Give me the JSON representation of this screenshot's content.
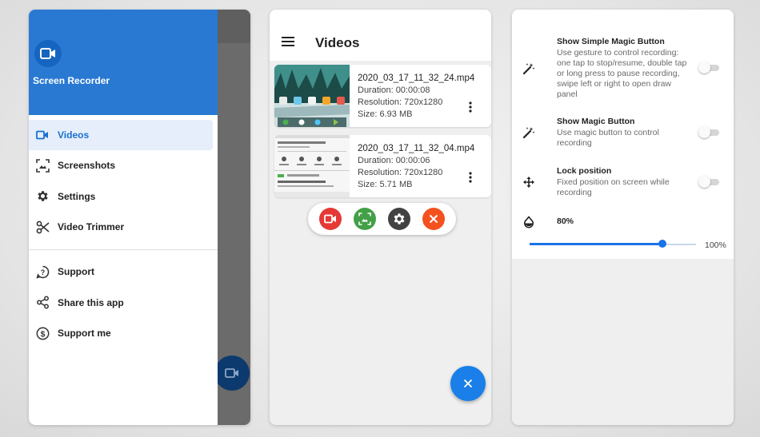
{
  "drawer": {
    "app_name": "Screen Recorder",
    "primary_items": [
      {
        "label": "Videos",
        "icon": "video-camera-icon",
        "active": true
      },
      {
        "label": "Screenshots",
        "icon": "screenshot-icon",
        "active": false
      },
      {
        "label": "Settings",
        "icon": "gear-icon",
        "active": false
      },
      {
        "label": "Video Trimmer",
        "icon": "scissors-icon",
        "active": false
      }
    ],
    "secondary_items": [
      {
        "label": "Support",
        "icon": "help-icon"
      },
      {
        "label": "Share this app",
        "icon": "share-icon"
      },
      {
        "label": "Support me",
        "icon": "dollar-icon"
      }
    ]
  },
  "videos_screen": {
    "title": "Videos",
    "videos": [
      {
        "filename": "2020_03_17_11_32_24.mp4",
        "duration": "Duration: 00:00:08",
        "resolution": "Resolution: 720x1280",
        "size": "Size: 6.93 MB"
      },
      {
        "filename": "2020_03_17_11_32_04.mp4",
        "duration": "Duration: 00:00:06",
        "resolution": "Resolution: 720x1280",
        "size": "Size: 5.71 MB"
      }
    ],
    "floating_controls": [
      {
        "icon": "record-icon",
        "color": "#e53935"
      },
      {
        "icon": "screenshot-icon",
        "color": "#43a047"
      },
      {
        "icon": "gear-icon",
        "color": "#424242"
      },
      {
        "icon": "close-icon",
        "color": "#f4511e"
      }
    ],
    "fab_icon": "close-icon"
  },
  "settings_screen": {
    "options": [
      {
        "icon": "magic-wand-icon",
        "title": "Show Simple Magic Button",
        "desc": "Use gesture to control recording: one tap to stop/resume, double tap or long press to pause recording, swipe left or right to open draw panel",
        "enabled": false
      },
      {
        "icon": "magic-wand-icon",
        "title": "Show Magic Button",
        "desc": "Use magic button to control recording",
        "enabled": false
      },
      {
        "icon": "move-icon",
        "title": "Lock position",
        "desc": "Fixed position on screen while recording",
        "enabled": false
      }
    ],
    "opacity": {
      "icon": "droplet-icon",
      "current_label": "80%",
      "max_label": "100%",
      "value": 0.8
    }
  },
  "colors": {
    "primary": "#2979d3",
    "fab": "#1a7fe8",
    "active_bg": "#e5eefa"
  }
}
